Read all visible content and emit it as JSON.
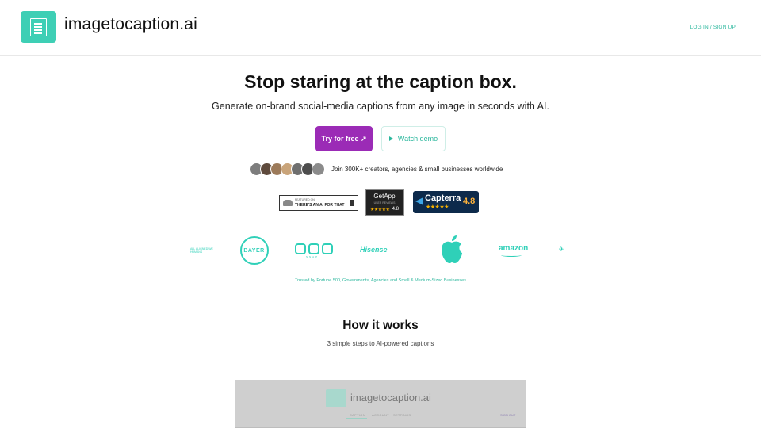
{
  "header": {
    "brand": "imagetocaption.ai",
    "auth_link": "LOG IN / SIGN UP"
  },
  "hero": {
    "headline": "Stop staring at the caption box.",
    "subheadline": "Generate on-brand social-media captions from any image in seconds with AI.",
    "primary_cta": "Try for free ↗",
    "secondary_cta": "Watch demo",
    "social_proof": "Join 300K+ creators, agencies & small businesses worldwide",
    "avatar_colors": [
      "#7d7d7d",
      "#5e4a3c",
      "#9c7a5a",
      "#c9a47a",
      "#6f6f6f",
      "#4d4d4d",
      "#8b8b8b"
    ]
  },
  "badges": {
    "aift_small": "FEATURED ON",
    "aift": "THERE'S AN AI FOR THAT",
    "getapp_title": "GetApp",
    "getapp_sub": "USER REVIEWS",
    "getapp_stars": "★★★★★",
    "getapp_score": "4.8",
    "capterra_name": "Capterra",
    "capterra_stars": "★★★★★",
    "capterra_score": "4.8"
  },
  "client_logos": {
    "govt": "ALL ALIGNED WE HUMANS",
    "bayer": "BAYER",
    "shapes_tag": "SNAP",
    "hisense": "Hisense",
    "amazon": "amazon",
    "partial": "✈"
  },
  "trusted_text": "Trusted by Fortune 500, Governments, Agencies and Small & Medium-Sized Businesses",
  "how_it_works": {
    "title": "How it works",
    "subtitle": "3 simple steps to AI-powered captions"
  },
  "preview": {
    "brand": "imagetocaption.ai",
    "nav": [
      "CAPTION",
      "ACCOUNT",
      "SETTINGS"
    ],
    "right_link": "SIGN OUT"
  },
  "colors": {
    "accent": "#3ecfb5",
    "link": "#2bb79d",
    "primary_button": "#9b2bb6",
    "capterra_bg": "#0d2a4b"
  }
}
